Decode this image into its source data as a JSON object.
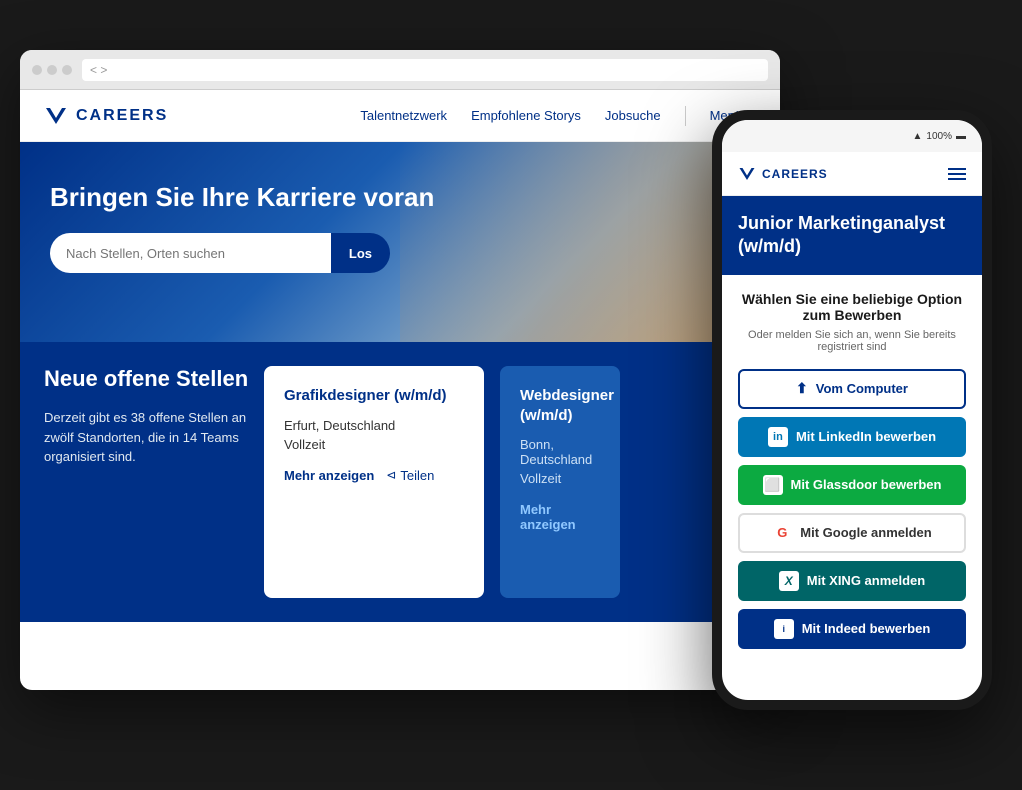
{
  "browser": {
    "addressbar_text": "< >"
  },
  "site": {
    "logo_letter": "V",
    "logo_text": "CAREERS",
    "nav": {
      "link1": "Talentnetzwerk",
      "link2": "Empfohlene Storys",
      "link3": "Jobsuche",
      "menu": "Menü"
    },
    "hero": {
      "title": "Bringen Sie Ihre Karriere voran",
      "search_placeholder": "Nach Stellen, Orten suchen",
      "search_btn": "Los"
    },
    "jobs_section": {
      "title": "Neue offene Stellen",
      "description": "Derzeit gibt es 38 offene Stellen an zwölf Standorten, die in 14 Teams organisiert sind.",
      "cards": [
        {
          "title": "Grafikdesigner (w/m/d)",
          "location": "Erfurt, Deutschland",
          "type": "Vollzeit",
          "more_link": "Mehr anzeigen",
          "share_link": "Teilen"
        },
        {
          "title": "Webdesigner (w/m/d)",
          "location": "Bonn, Deutschland",
          "type": "Vollzeit",
          "more_link": "Mehr anzeigen"
        }
      ]
    }
  },
  "mobile": {
    "status_time": "",
    "status_battery": "100%",
    "logo_letter": "V",
    "logo_text": "CAREERS",
    "job_title": "Junior Marketinganalyst (w/m/d)",
    "apply": {
      "heading": "Wählen Sie eine beliebige Option zum Bewerben",
      "subtext": "Oder melden Sie sich an, wenn Sie bereits registriert sind",
      "btn_computer": "Vom Computer",
      "btn_linkedin": "Mit LinkedIn bewerben",
      "btn_glassdoor": "Mit Glassdoor bewerben",
      "btn_google": "Mit Google anmelden",
      "btn_xing": "Mit XING anmelden",
      "btn_indeed": "Mit Indeed bewerben"
    }
  }
}
